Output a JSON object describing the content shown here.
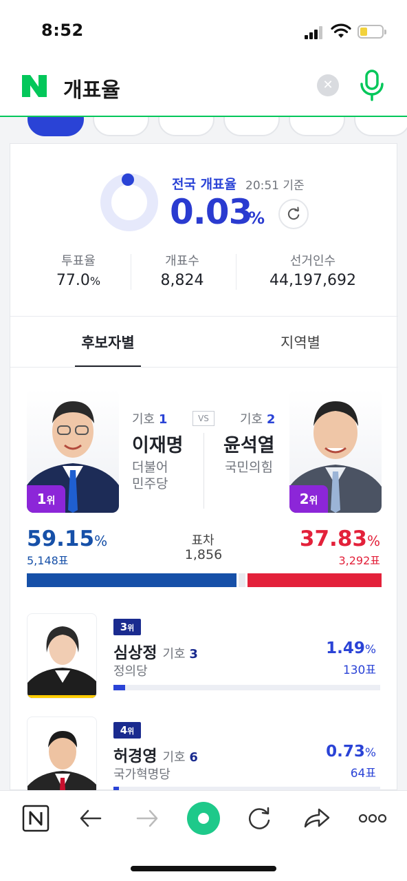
{
  "status": {
    "time": "8:52"
  },
  "search": {
    "query": "개표율"
  },
  "national": {
    "label": "전국 개표율",
    "as_of": "20:51 기준",
    "rate": "0.03",
    "rate_unit": "%",
    "rate_fraction": 0.0003,
    "stats": [
      {
        "label": "투표율",
        "value": "77.0",
        "unit": "%"
      },
      {
        "label": "개표수",
        "value": "8,824",
        "unit": ""
      },
      {
        "label": "선거인수",
        "value": "44,197,692",
        "unit": ""
      }
    ]
  },
  "subtabs": [
    "후보자별",
    "지역별"
  ],
  "top2": {
    "left": {
      "rank": "1",
      "rank_suffix": "위",
      "gi_label": "기호",
      "gi_num": "1",
      "name": "이재명",
      "party_line1": "더불어",
      "party_line2": "민주당",
      "pct": "59.15",
      "pct_unit": "%",
      "votes": "5,148표",
      "color": "#1650a8"
    },
    "right": {
      "rank": "2",
      "rank_suffix": "위",
      "gi_label": "기호",
      "gi_num": "2",
      "name": "윤석열",
      "party_line1": "국민의힘",
      "pct": "37.83",
      "pct_unit": "%",
      "votes": "3,292표",
      "color": "#e3213a"
    },
    "vs": "VS",
    "gap_label": "표차",
    "gap_value": "1,856"
  },
  "others": [
    {
      "rank": "3",
      "rank_suffix": "위",
      "name": "심상정",
      "gi_label": "기호",
      "gi_num": "3",
      "party": "정의당",
      "pct": "1.49",
      "pct_unit": "%",
      "votes": "130표",
      "fraction": 0.0149
    },
    {
      "rank": "4",
      "rank_suffix": "위",
      "name": "허경영",
      "gi_label": "기호",
      "gi_num": "6",
      "party": "국가혁명당",
      "pct": "0.73",
      "pct_unit": "%",
      "votes": "64표",
      "fraction": 0.0073
    }
  ],
  "colors": {
    "naver_green": "#03c75a",
    "accent_blue": "#2a43d6",
    "rank_purple": "#8c26d8"
  },
  "toolbar": {
    "icons": [
      "naver-home-icon",
      "back-icon",
      "forward-icon",
      "green-dot-icon",
      "refresh-icon",
      "share-icon",
      "more-icon"
    ]
  }
}
